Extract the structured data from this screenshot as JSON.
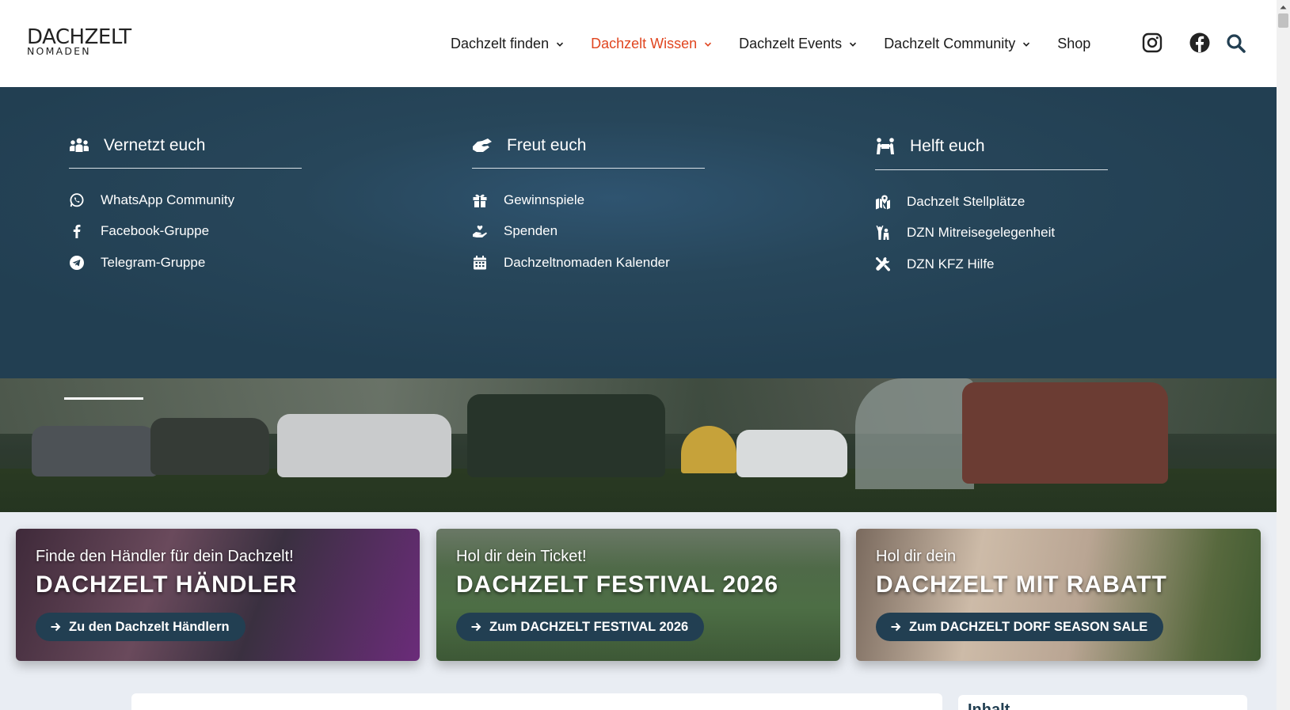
{
  "logo": {
    "line1": "DACHZELT",
    "line2": "NOMADEN"
  },
  "nav": {
    "items": [
      {
        "label": "Dachzelt finden"
      },
      {
        "label": "Dachzelt Wissen"
      },
      {
        "label": "Dachzelt Events"
      },
      {
        "label": "Dachzelt Community"
      }
    ],
    "shop": "Shop",
    "active_color": "#e0451f"
  },
  "header_icons": [
    "instagram-icon",
    "facebook-icon",
    "search-icon"
  ],
  "mega_menu": {
    "columns": [
      {
        "title": "Vernetzt euch",
        "icon": "people-group-icon",
        "items": [
          {
            "label": "WhatsApp Community",
            "icon": "whatsapp-icon"
          },
          {
            "label": "Facebook-Gruppe",
            "icon": "facebook-f-icon"
          },
          {
            "label": "Telegram-Gruppe",
            "icon": "telegram-icon"
          }
        ]
      },
      {
        "title": "Freut euch",
        "icon": "handshake-icon",
        "items": [
          {
            "label": "Gewinnspiele",
            "icon": "gift-icon"
          },
          {
            "label": "Spenden",
            "icon": "donate-hand-icon"
          },
          {
            "label": "Dachzeltnomaden Kalender",
            "icon": "calendar-icon"
          }
        ]
      },
      {
        "title": "Helft euch",
        "icon": "people-carry-icon",
        "items": [
          {
            "label": "Dachzelt Stellplätze",
            "icon": "map-marker-icon"
          },
          {
            "label": "DZN Mitreisegelegenheit",
            "icon": "people-arms-up-icon"
          },
          {
            "label": "DZN KFZ Hilfe",
            "icon": "tools-icon"
          }
        ]
      }
    ],
    "background": "#223f52"
  },
  "cards": [
    {
      "kicker": "Finde den Händler für dein Dachzelt!",
      "title": "DACHZELT HÄNDLER",
      "button": "Zu den Dachzelt Händlern"
    },
    {
      "kicker": "Hol dir dein Ticket!",
      "title": "DACHZELT FESTIVAL 2026",
      "button": "Zum DACHZELT FESTIVAL 2026"
    },
    {
      "kicker": "Hol dir dein",
      "title": "DACHZELT MIT RABATT",
      "button": "Zum DACHZELT DORF SEASON SALE"
    }
  ],
  "sidebar": {
    "label": "Inhalt"
  }
}
